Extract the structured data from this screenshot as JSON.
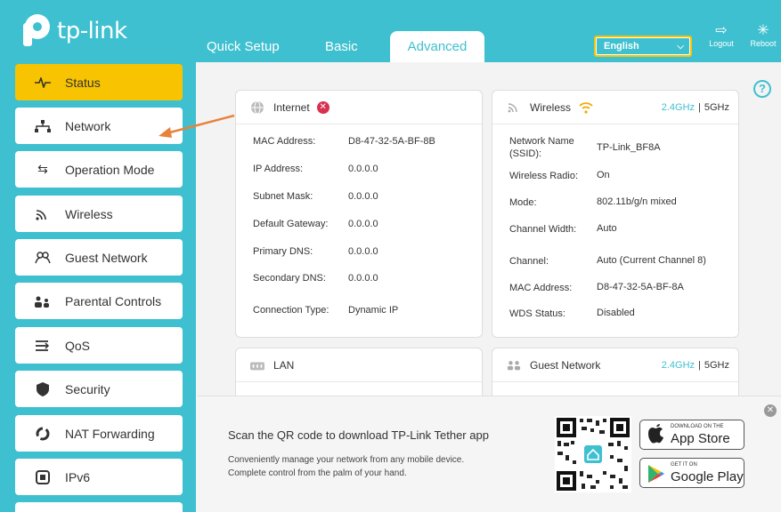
{
  "header": {
    "brand": "tp-link",
    "tabs": [
      "Quick Setup",
      "Basic",
      "Advanced"
    ],
    "language": "English",
    "logout_label": "Logout",
    "reboot_label": "Reboot"
  },
  "sidebar": {
    "items": [
      {
        "label": "Status",
        "icon": "pulse-icon"
      },
      {
        "label": "Network",
        "icon": "network-icon"
      },
      {
        "label": "Operation Mode",
        "icon": "swap-icon"
      },
      {
        "label": "Wireless",
        "icon": "wifi-icon"
      },
      {
        "label": "Guest Network",
        "icon": "guest-icon"
      },
      {
        "label": "Parental Controls",
        "icon": "parental-icon"
      },
      {
        "label": "QoS",
        "icon": "qos-icon"
      },
      {
        "label": "Security",
        "icon": "shield-icon"
      },
      {
        "label": "NAT Forwarding",
        "icon": "nat-icon"
      },
      {
        "label": "IPv6",
        "icon": "ipv6-icon"
      }
    ]
  },
  "internet": {
    "title": "Internet",
    "rows": [
      {
        "label": "MAC Address:",
        "value": "D8-47-32-5A-BF-8B"
      },
      {
        "label": "IP Address:",
        "value": "0.0.0.0"
      },
      {
        "label": "Subnet Mask:",
        "value": "0.0.0.0"
      },
      {
        "label": "Default Gateway:",
        "value": "0.0.0.0"
      },
      {
        "label": "Primary DNS:",
        "value": "0.0.0.0"
      },
      {
        "label": "Secondary DNS:",
        "value": "0.0.0.0"
      },
      {
        "label": "Connection Type:",
        "value": "Dynamic IP"
      }
    ]
  },
  "wireless": {
    "title": "Wireless",
    "band_24": "2.4GHz",
    "band_sep": "|",
    "band_5": "5GHz",
    "rows": [
      {
        "label": "Network Name (SSID):",
        "value": "TP-Link_BF8A"
      },
      {
        "label": "Wireless Radio:",
        "value": "On"
      },
      {
        "label": "Mode:",
        "value": "802.11b/g/n mixed"
      },
      {
        "label": "Channel Width:",
        "value": "Auto"
      },
      {
        "label": "Channel:",
        "value": "Auto (Current Channel 8)"
      },
      {
        "label": "MAC Address:",
        "value": "D8-47-32-5A-BF-8A"
      },
      {
        "label": "WDS Status:",
        "value": "Disabled"
      }
    ]
  },
  "lan": {
    "title": "LAN"
  },
  "guest": {
    "title": "Guest Network",
    "band_24": "2.4GHz",
    "band_sep": "|",
    "band_5": "5GHz"
  },
  "banner": {
    "title": "Scan the QR code to download TP-Link Tether app",
    "line1": "Conveniently manage your network from any mobile device.",
    "line2": "Complete control from the palm of your hand.",
    "appstore_small": "DOWNLOAD ON THE",
    "appstore_big": "App Store",
    "gplay_small": "GET IT ON",
    "gplay_big": "Google Play"
  },
  "colors": {
    "accent": "#3fc0d0",
    "active": "#f8c300",
    "arrow": "#e8823a",
    "error": "#d9304f"
  }
}
